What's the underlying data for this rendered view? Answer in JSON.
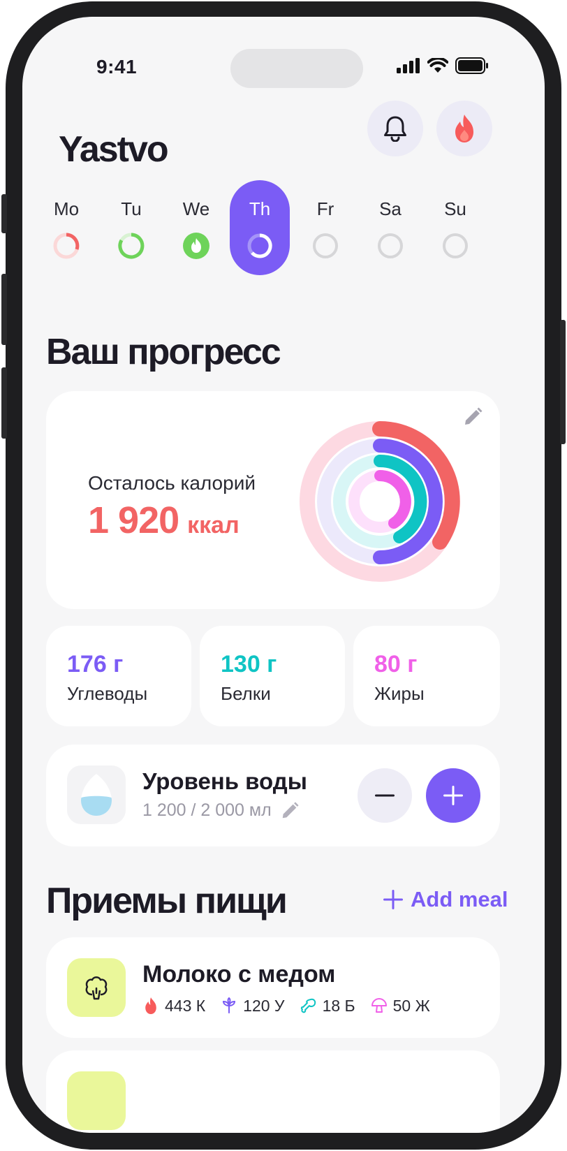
{
  "status": {
    "time": "9:41"
  },
  "header": {
    "title": "Yastvo"
  },
  "week": [
    {
      "label": "Mo",
      "state": "partial-red"
    },
    {
      "label": "Tu",
      "state": "green-ring"
    },
    {
      "label": "We",
      "state": "green-done"
    },
    {
      "label": "Th",
      "state": "active"
    },
    {
      "label": "Fr",
      "state": "empty"
    },
    {
      "label": "Sa",
      "state": "empty"
    },
    {
      "label": "Su",
      "state": "empty"
    }
  ],
  "progress": {
    "title": "Ваш прогресс",
    "calories_label": "Осталось калорий",
    "calories_value": "1 920",
    "calories_unit": "ккал"
  },
  "macros": [
    {
      "value": "176 г",
      "name": "Углеводы",
      "color": "#7b5cf5"
    },
    {
      "value": "130 г",
      "name": "Белки",
      "color": "#0fc4c4"
    },
    {
      "value": "80 г",
      "name": "Жиры",
      "color": "#f060e8"
    }
  ],
  "water": {
    "title": "Уровень воды",
    "amount": "1 200 / 2 000 мл"
  },
  "meals": {
    "title": "Приемы пищи",
    "add_label": "Add meal",
    "items": [
      {
        "name": "Молоко с медом",
        "kcal": "443 К",
        "carbs": "120 У",
        "protein": "18 Б",
        "fat": "50 Ж"
      }
    ]
  },
  "colors": {
    "accent": "#7b5cf5",
    "calories": "#f26464",
    "protein": "#0fc4c4",
    "fat": "#f060e8"
  }
}
